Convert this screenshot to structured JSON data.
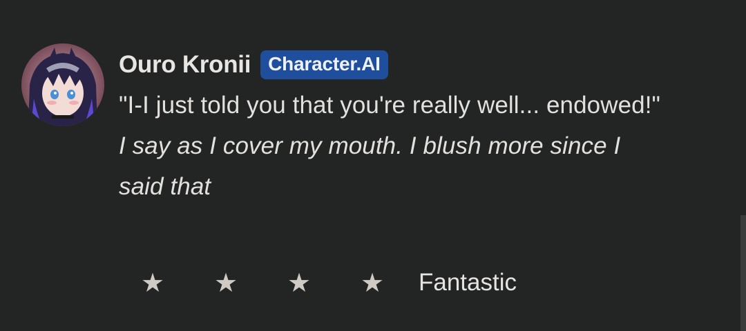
{
  "message": {
    "author": "Ouro Kronii",
    "badge": "Character.AI",
    "speech": "\"I-I just told you that you're really well... endowed!\"",
    "action": "I say as I cover my mouth. I blush more since I said that"
  },
  "rating": {
    "stars": [
      "★",
      "★",
      "★",
      "★"
    ],
    "label": "Fantastic"
  },
  "colors": {
    "background": "#232424",
    "badge": "#1f4f9c"
  }
}
